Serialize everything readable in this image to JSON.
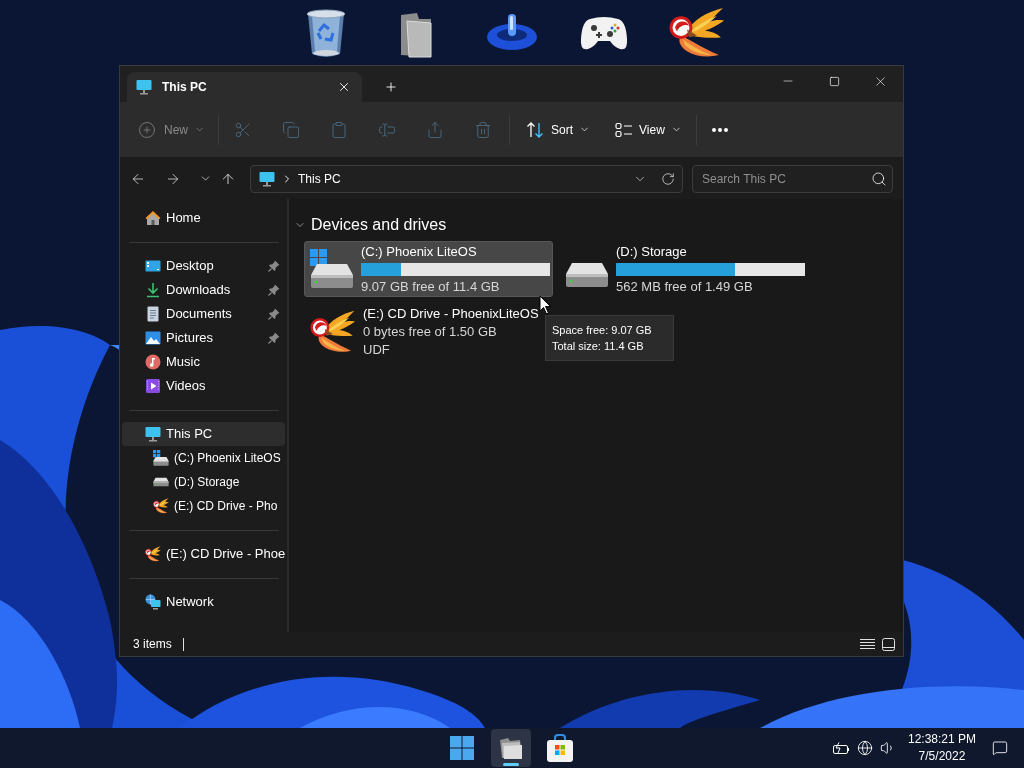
{
  "window": {
    "tabs": [
      {
        "label": "This PC",
        "selected": true
      }
    ]
  },
  "toolbar": {
    "new": {
      "label": "New",
      "disabled": true
    },
    "item_actions": {
      "disabled": true
    },
    "sort": {
      "label": "Sort"
    },
    "view": {
      "label": "View"
    }
  },
  "address_bar": {
    "location": "This PC"
  },
  "search": {
    "placeholder": "Search This PC"
  },
  "sidebar": {
    "sections": [
      {
        "items": [
          {
            "kind": "home",
            "label": "Home",
            "pinned": false,
            "selected": false
          }
        ]
      },
      {
        "items": [
          {
            "kind": "desktop",
            "label": "Desktop",
            "pinned": true,
            "selected": false
          },
          {
            "kind": "downloads",
            "label": "Downloads",
            "pinned": true,
            "selected": false
          },
          {
            "kind": "documents",
            "label": "Documents",
            "pinned": true,
            "selected": false
          },
          {
            "kind": "pictures",
            "label": "Pictures",
            "pinned": true,
            "selected": false
          },
          {
            "kind": "music",
            "label": "Music",
            "pinned": false,
            "selected": false
          },
          {
            "kind": "videos",
            "label": "Videos",
            "pinned": false,
            "selected": false
          }
        ]
      },
      {
        "items": [
          {
            "kind": "pc",
            "label": "This PC",
            "pinned": false,
            "selected": true,
            "children": [
              {
                "kind": "system-drive",
                "label": "(C:) Phoenix LiteOS",
                "pinned": false,
                "selected": false
              },
              {
                "kind": "drive",
                "label": "(D:) Storage",
                "pinned": false,
                "selected": false
              },
              {
                "kind": "cd-drive",
                "label": "(E:) CD Drive - Pho",
                "pinned": false,
                "selected": false
              }
            ]
          }
        ]
      },
      {
        "items": [
          {
            "kind": "cd-drive",
            "label": "(E:) CD Drive - Phoe",
            "pinned": false,
            "selected": false
          }
        ]
      },
      {
        "items": [
          {
            "kind": "network",
            "label": "Network",
            "pinned": false,
            "selected": false
          }
        ]
      }
    ]
  },
  "content": {
    "group": {
      "title": "Devices and drives",
      "expanded": true
    },
    "drives": [
      {
        "kind": "system-drive",
        "name": "(C:) Phoenix LiteOS",
        "level": 0.21,
        "free": "9.07 GB free of 11.4 GB",
        "selected": true
      },
      {
        "kind": "drive",
        "name": "(D:) Storage",
        "level": 0.63,
        "free": "562 MB free of 1.49 GB",
        "selected": false
      },
      {
        "kind": "cd-drive",
        "name": "(E:) CD Drive - PhoenixLiteOS",
        "free": "0 bytes free of 1.50 GB",
        "filesystem": "UDF",
        "selected": false
      }
    ]
  },
  "tooltip": {
    "lines": [
      "Space free: 9.07 GB",
      "Total size: 11.4 GB"
    ]
  },
  "status_bar": {
    "item_count": "3 items"
  },
  "taskbar": {
    "apps": [
      {
        "kind": "start",
        "active": false
      },
      {
        "kind": "file-explorer",
        "active": true
      },
      {
        "kind": "store",
        "active": false
      }
    ],
    "time": "12:38:21 PM",
    "date": "7/5/2022"
  }
}
